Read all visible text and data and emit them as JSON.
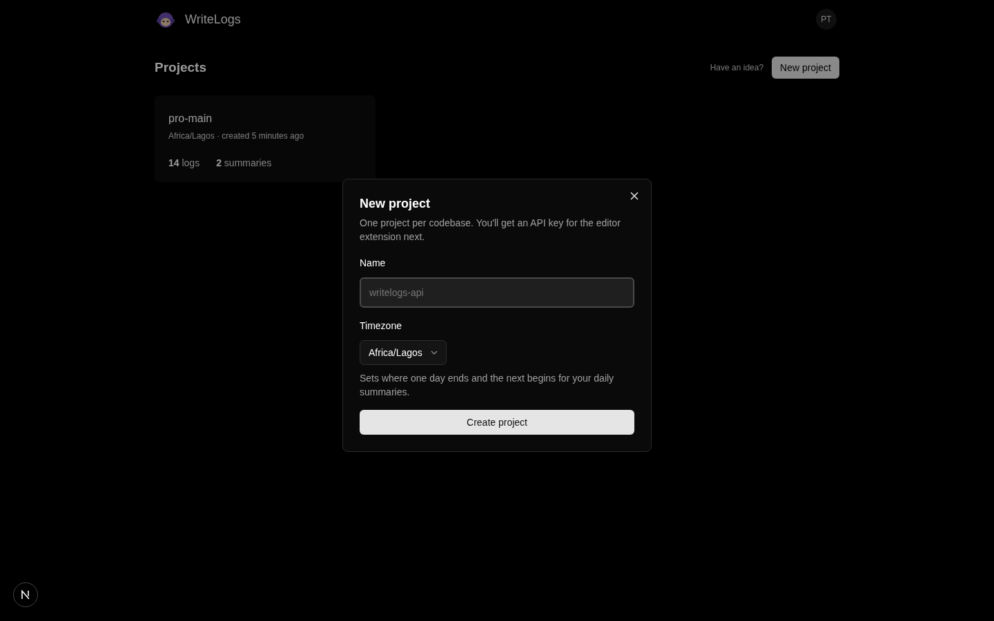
{
  "header": {
    "brand": "WriteLogs",
    "avatar": "PT"
  },
  "page": {
    "title": "Projects",
    "idea_link": "Have an idea?",
    "new_button": "New project"
  },
  "projects": [
    {
      "name": "pro-main",
      "meta": "Africa/Lagos · created 5 minutes ago",
      "stats": [
        "**14** logs",
        "**2** summaries"
      ]
    }
  ],
  "dialog": {
    "title": "New project",
    "description": "One project per codebase. You'll get an API key for the editor extension next.",
    "name_label": "Name",
    "name_placeholder": "writelogs-api",
    "timezone_label": "Timezone",
    "timezone_value": "Africa/Lagos",
    "timezone_hint": "Sets where one day ends and the next begins for your daily summaries.",
    "submit": "Create project"
  }
}
